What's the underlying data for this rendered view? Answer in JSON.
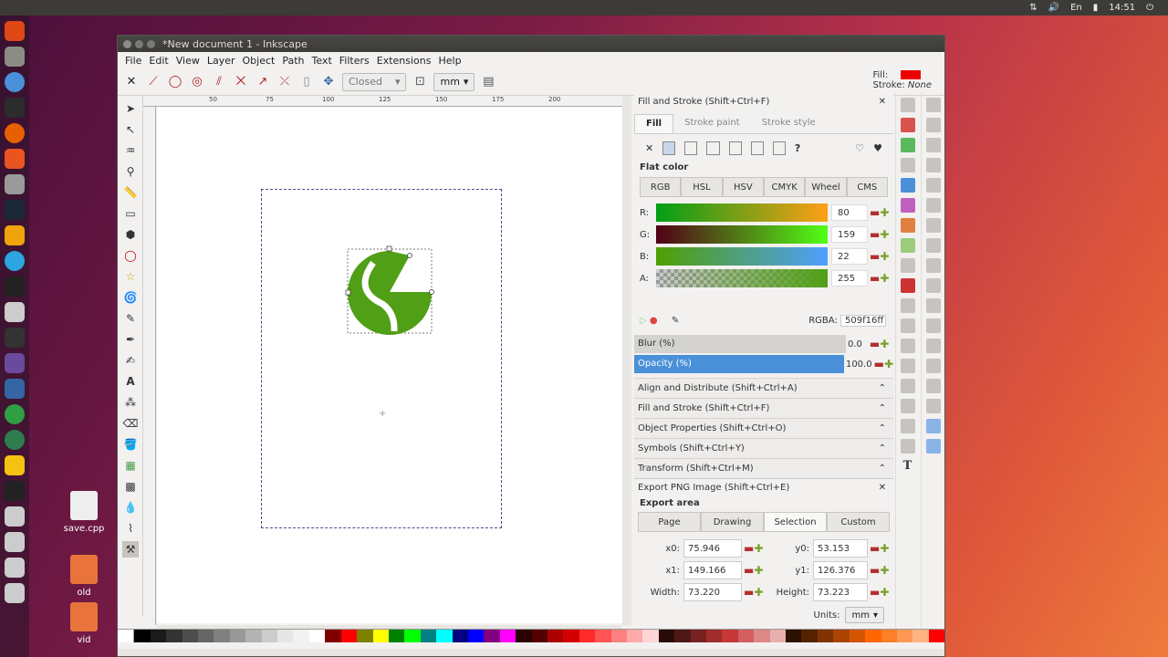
{
  "topbar": {
    "time": "14:51",
    "lang": "En"
  },
  "desktop": [
    {
      "label": "save.cpp"
    },
    {
      "label": "old"
    },
    {
      "label": "vid"
    }
  ],
  "window": {
    "title": "*New document 1 - Inkscape"
  },
  "menu": [
    "File",
    "Edit",
    "View",
    "Layer",
    "Object",
    "Path",
    "Text",
    "Filters",
    "Extensions",
    "Help"
  ],
  "cmdbar": {
    "shape_combo": "Closed",
    "unit": "mm"
  },
  "fill_info": {
    "fill_label": "Fill:",
    "stroke_label": "Stroke:",
    "stroke_value": "None"
  },
  "ruler": [
    "50",
    "75",
    "100",
    "125",
    "150",
    "175",
    "200"
  ],
  "fill_stroke": {
    "header": "Fill and Stroke (Shift+Ctrl+F)",
    "tabs": [
      "Fill",
      "Stroke paint",
      "Stroke style"
    ],
    "mode": "Flat color",
    "color_tabs": [
      "RGB",
      "HSL",
      "HSV",
      "CMYK",
      "Wheel",
      "CMS"
    ],
    "r_label": "R:",
    "r": "80",
    "g_label": "G:",
    "g": "159",
    "b_label": "B:",
    "b": "22",
    "a_label": "A:",
    "a": "255",
    "rgba_label": "RGBA:",
    "rgba": "509f16ff",
    "blur_label": "Blur (%)",
    "blur": "0.0",
    "opacity_label": "Opacity (%)",
    "opacity": "100.0",
    "unknown_icon": "?"
  },
  "collapsed": [
    "Align and Distribute (Shift+Ctrl+A)",
    "Fill and Stroke (Shift+Ctrl+F)",
    "Object Properties (Shift+Ctrl+O)",
    "Symbols (Shift+Ctrl+Y)",
    "Transform (Shift+Ctrl+M)"
  ],
  "export": {
    "header": "Export PNG Image (Shift+Ctrl+E)",
    "area_label": "Export area",
    "tabs": [
      "Page",
      "Drawing",
      "Selection",
      "Custom"
    ],
    "x0_label": "x0:",
    "x0": "75.946",
    "y0_label": "y0:",
    "y0": "53.153",
    "x1_label": "x1:",
    "x1": "149.166",
    "y1_label": "y1:",
    "y1": "126.376",
    "width_label": "Width:",
    "width": "73.220",
    "height_label": "Height:",
    "height": "73.223",
    "units_label": "Units:",
    "units": "mm"
  },
  "colors": {
    "shape": "#509f16",
    "fill_swatch": "#e00000",
    "accent": "#4a90d9"
  }
}
